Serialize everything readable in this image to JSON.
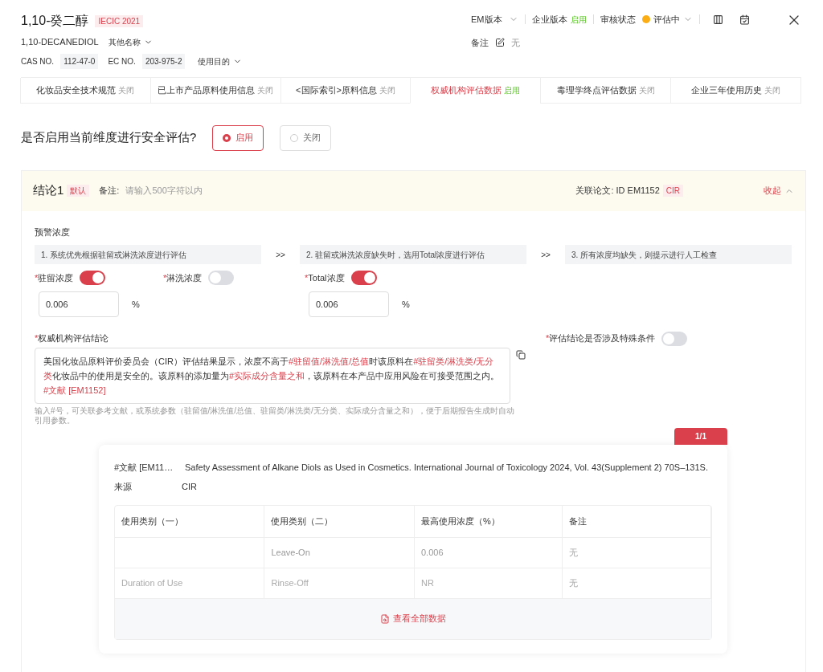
{
  "header": {
    "name": "1,10-癸二醇",
    "badge": "IECIC 2021",
    "english_name": "1,10-DECANEDIOL",
    "other_names": "其他名称",
    "cas_label": "CAS NO.",
    "cas": "112-47-0",
    "ec_label": "EC NO.",
    "ec": "203-975-2",
    "purpose": "使用目的"
  },
  "toolbar": {
    "em_version": "EM版本",
    "enterprise_label": "企业版本",
    "enterprise_status": "启用",
    "review_label": "审核状态",
    "review_status": "评估中",
    "note_label": "备注",
    "note_value": "无"
  },
  "tabs": [
    {
      "label": "化妆品安全技术规范",
      "status": "关闭",
      "on": false,
      "selected": false
    },
    {
      "label": "已上市产品原料使用信息",
      "status": "关闭",
      "on": false,
      "selected": false
    },
    {
      "label": "<国际索引>原料信息",
      "status": "关闭",
      "on": false,
      "selected": false
    },
    {
      "label": "权威机构评估数据",
      "status": "启用",
      "on": true,
      "selected": true
    },
    {
      "label": "毒理学终点评估数据",
      "status": "关闭",
      "on": false,
      "selected": false
    },
    {
      "label": "企业三年使用历史",
      "status": "关闭",
      "on": false,
      "selected": false
    }
  ],
  "question": {
    "text": "是否启用当前维度进行安全评估?",
    "options": [
      {
        "label": "启用",
        "selected": true
      },
      {
        "label": "关闭",
        "selected": false
      }
    ]
  },
  "conclusion": {
    "title": "结论1",
    "default_badge": "默认",
    "note_label": "备注:",
    "note_placeholder": "请输入500字符以内",
    "paper_label": "关联论文: ID EM1152",
    "paper_tag": "CIR",
    "collapse": "收起",
    "expanded": true,
    "warning_label": "预警浓度",
    "steps": [
      "1. 系统优先根据驻留或淋洗浓度进行评估",
      "2. 驻留或淋洗浓度缺失时，选用Total浓度进行评估",
      "3. 所有浓度均缺失，则提示进行人工检查"
    ],
    "step_separator": ">>",
    "concentrations": [
      {
        "mark": "*",
        "label": "驻留浓度",
        "on": true,
        "value": "0.006",
        "unit": "%"
      },
      {
        "mark": "*",
        "label": "淋洗浓度",
        "on": false
      },
      {
        "mark": "*",
        "label": "Total浓度",
        "on": true,
        "value": "0.006",
        "unit": "%"
      }
    ],
    "result_mark": "*",
    "result_label": "权威机构评估结论",
    "special_mark": "*",
    "special_label": "评估结论是否涉及特殊条件",
    "special_on": false,
    "result_text": [
      {
        "text": "美国化妆品原料评价委员会（CIR）评估结果显示，浓度不高于",
        "ref": false
      },
      {
        "text": "#驻留值/淋洗值/总值",
        "ref": true
      },
      {
        "text": "时该原料在",
        "ref": false
      },
      {
        "text": "#驻留类/淋洗类/无分类",
        "ref": true
      },
      {
        "text": "化妆品中的使用是安全的。该原料的添加量为",
        "ref": false
      },
      {
        "text": "#实际成分含量之和",
        "ref": true
      },
      {
        "text": "，该原料在本产品中应用风险在可接受范围之内。",
        "ref": false
      },
      {
        "text": "#文献 [EM1152]",
        "ref": true
      }
    ],
    "hint": "输入#号，可关联参考文献，或系统参数（驻留值/淋洗值/总值、驻留类/淋洗类/无分类、实际成分含量之和），便于后期报告生成时自动引用参数。"
  },
  "popup": {
    "pager": "1/1",
    "ref_label": "#文献 [EM11…",
    "ref_text": "Safety Assessment of Alkane Diols as Used in Cosmetics. International Journal of Toxicology 2024, Vol. 43(Supplement 2) 70S–131S.",
    "source_label": "来源",
    "source": "CIR",
    "table": {
      "columns": [
        "使用类别（一）",
        "使用类别（二）",
        "最高使用浓度（%）",
        "备注"
      ],
      "rows": [
        [
          "",
          "Leave-On",
          "0.006",
          "无"
        ],
        [
          "Duration of Use",
          "Rinse-Off",
          "NR",
          "无"
        ]
      ]
    },
    "view_all": "查看全部数据"
  }
}
